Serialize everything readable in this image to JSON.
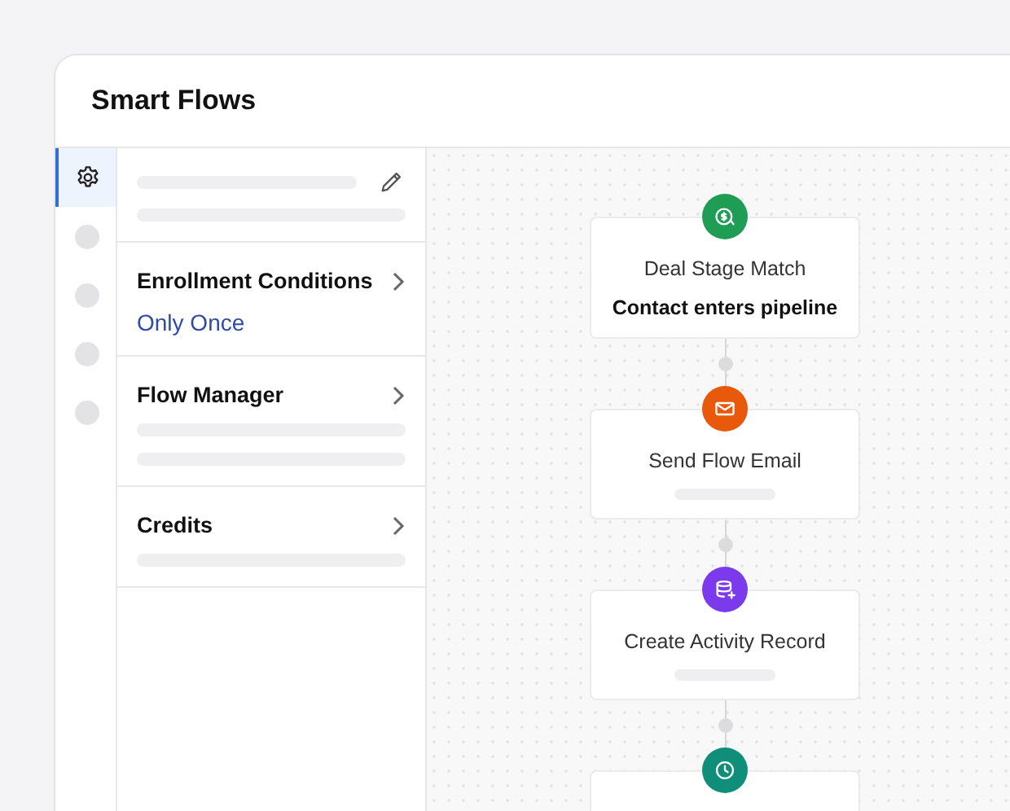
{
  "window": {
    "title": "Smart Flows"
  },
  "rail": [
    {
      "kind": "settings",
      "selected": true
    },
    {
      "kind": "placeholder",
      "selected": false
    },
    {
      "kind": "placeholder",
      "selected": false
    },
    {
      "kind": "placeholder",
      "selected": false
    },
    {
      "kind": "placeholder",
      "selected": false
    }
  ],
  "sections": [
    {
      "kind": "value",
      "title": "Enrollment Conditions",
      "value": "Only Once"
    },
    {
      "kind": "details",
      "title": "Flow Manager"
    },
    {
      "kind": "summary",
      "title": "Credits"
    }
  ],
  "steps": [
    {
      "kind": "trigger",
      "color": "#1f9d55",
      "title": "Deal Stage Match",
      "subtitle": "Contact enters pipeline"
    },
    {
      "kind": "email",
      "color": "#e8590c",
      "title": "Send Flow Email"
    },
    {
      "kind": "record",
      "color": "#7c3aed",
      "title": "Create Activity Record"
    },
    {
      "kind": "wait",
      "color": "#0f8f7a"
    }
  ]
}
